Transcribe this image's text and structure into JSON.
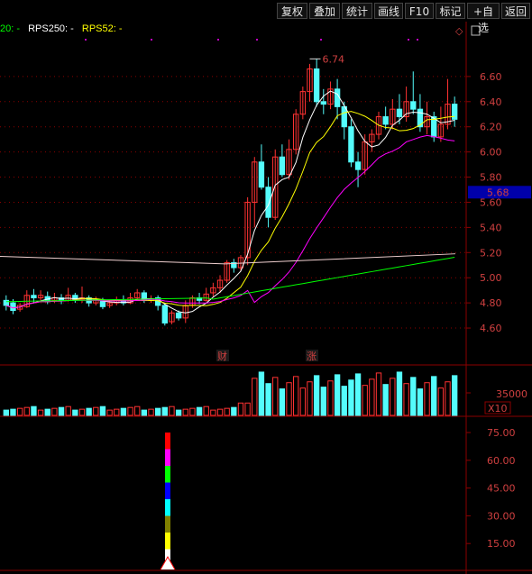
{
  "toolbar": {
    "buttons": [
      {
        "label": "复权",
        "icon": ""
      },
      {
        "label": "叠加",
        "icon": ""
      },
      {
        "label": "统计",
        "icon": ""
      },
      {
        "label": "画线",
        "icon": ""
      },
      {
        "label": "F10",
        "icon": ""
      },
      {
        "label": "标记",
        "icon": ""
      },
      {
        "label": "+自选",
        "icon": ""
      },
      {
        "label": "返回",
        "icon": ""
      }
    ]
  },
  "legend": {
    "rps20": "20: -",
    "rps250": "RPS250: -",
    "rps52": "RPS52: -",
    "colors": {
      "rps20": "#00ff00",
      "rps250": "#ffffff",
      "rps52": "#ffff00"
    }
  },
  "price_panel": {
    "y_ticks": [
      "6.60",
      "6.40",
      "6.20",
      "6.00",
      "5.80",
      "5.60",
      "5.40",
      "5.20",
      "5.00",
      "4.80",
      "4.60"
    ],
    "current_price": "5.68",
    "high_annotation": "6.74",
    "markers": [
      {
        "text": "财",
        "color": "#4a90e2"
      },
      {
        "text": "涨",
        "color": "#d04040"
      }
    ]
  },
  "volume_panel": {
    "y_tick": "35000",
    "unit_badge": "X10"
  },
  "indicator_panel": {
    "y_ticks": [
      "75.00",
      "60.00",
      "45.00",
      "30.00",
      "15.00"
    ]
  },
  "colors": {
    "up": "#ff3232",
    "down": "#54fcfc",
    "ma5": "#ffffff",
    "ma10": "#ffff00",
    "ma20": "#ff00ff",
    "ma60": "#00ff00",
    "ma250": "#f0d0d0",
    "grid": "#8b0000",
    "axis_text": "#d04040"
  }
}
